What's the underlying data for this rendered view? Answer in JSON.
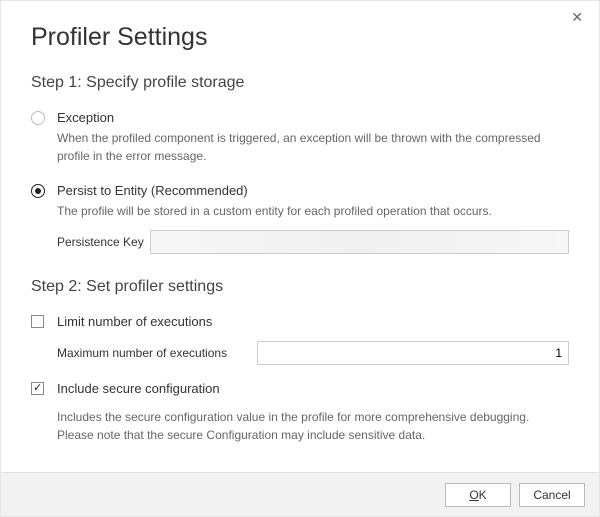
{
  "dialog": {
    "title": "Profiler Settings"
  },
  "step1": {
    "heading": "Step 1: Specify profile storage",
    "optionA": {
      "label": "Exception",
      "desc": "When the profiled component is triggered, an exception will be thrown with the compressed profile in the error message."
    },
    "optionB": {
      "label": "Persist to Entity (Recommended)",
      "desc": "The profile will be stored in a custom entity for each profiled operation that occurs.",
      "field_label": "Persistence Key",
      "field_value": ""
    }
  },
  "step2": {
    "heading": "Step 2: Set profiler settings",
    "limit": {
      "label": "Limit number of executions",
      "max_label": "Maximum number of executions",
      "max_value": "1"
    },
    "secure": {
      "label": "Include secure configuration",
      "desc": "Includes the secure configuration value in the profile for more comprehensive debugging. Please note that the secure Configuration may include sensitive data."
    }
  },
  "footer": {
    "ok": "OK",
    "cancel": "Cancel"
  }
}
